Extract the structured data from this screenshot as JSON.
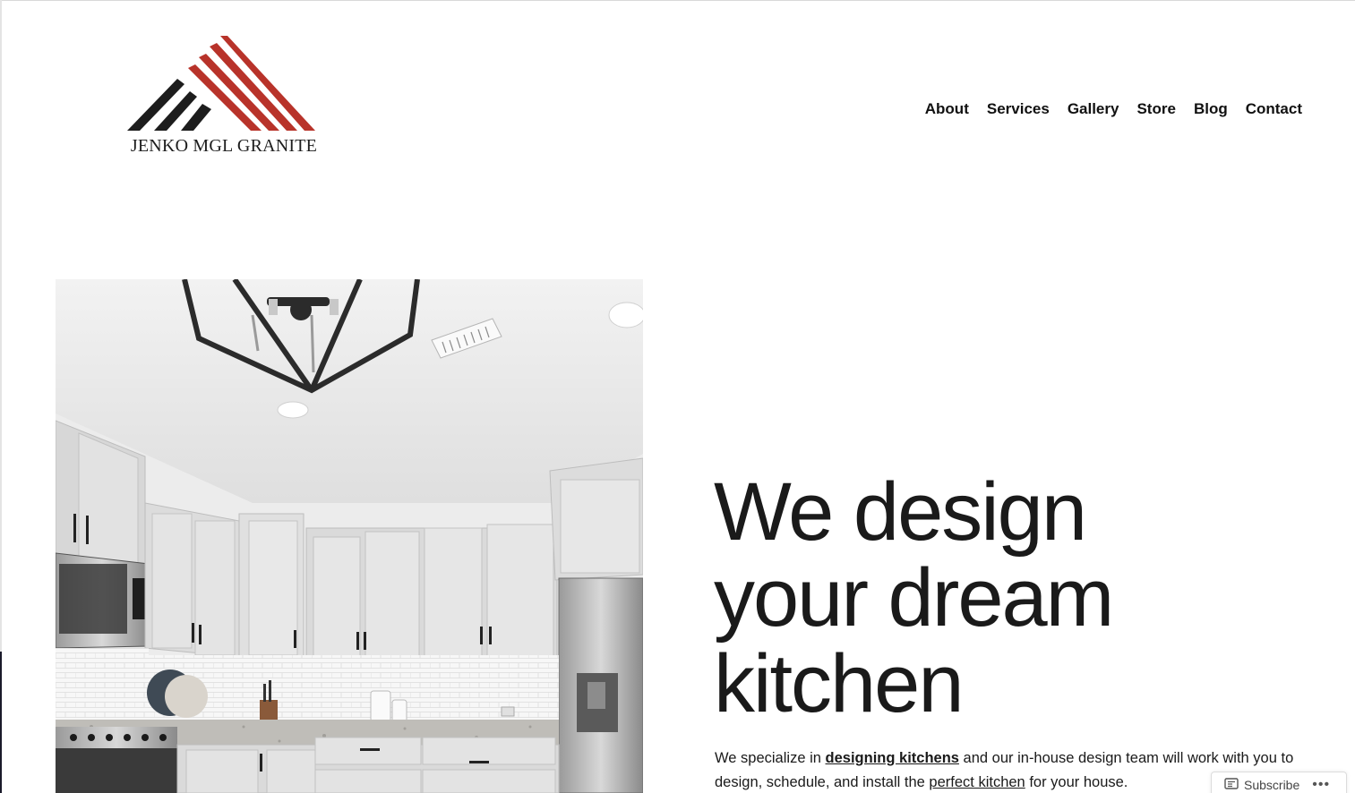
{
  "site": {
    "logo_text": "JENKO MGL GRANITE",
    "brand_colors": {
      "red": "#b8332a",
      "dark": "#1d1d1d"
    }
  },
  "nav": {
    "items": [
      {
        "label": "About"
      },
      {
        "label": "Services"
      },
      {
        "label": "Gallery"
      },
      {
        "label": "Store"
      },
      {
        "label": "Blog"
      },
      {
        "label": "Contact"
      }
    ]
  },
  "hero": {
    "image_icon": "kitchen-photo",
    "headline_lines": [
      "We design",
      "your dream",
      "kitchen"
    ],
    "intro": {
      "part1": "We specialize in ",
      "link1": "designing kitchens",
      "part2": " and our in-house design team will work with you to design, schedule, and install the ",
      "link2": "perfect kitchen",
      "part3": " for your house."
    }
  },
  "subscribe_bar": {
    "subscribe_label": "Subscribe",
    "subscribe_icon": "reader-icon",
    "more_icon": "more-dots-icon",
    "more_label": "•••"
  }
}
